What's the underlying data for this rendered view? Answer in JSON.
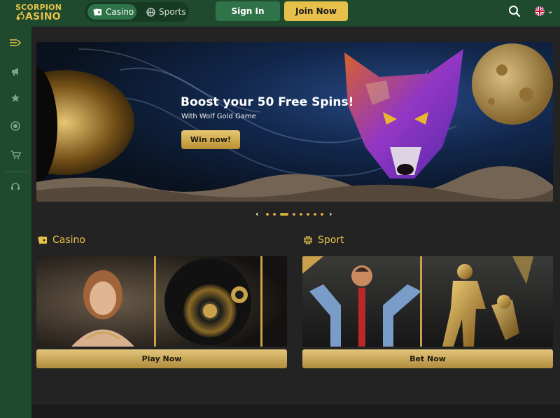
{
  "brand": {
    "line1": "SCORPION",
    "line2": "ASINO"
  },
  "header": {
    "tabs": [
      {
        "label": "Casino",
        "icon": "cards-icon",
        "active": true
      },
      {
        "label": "Sports",
        "icon": "basketball-icon",
        "active": false
      }
    ],
    "signin_label": "Sign In",
    "join_label": "Join Now",
    "search_icon": "search-icon",
    "language_icon": "uk-flag-icon"
  },
  "sidebar": {
    "items": [
      {
        "icon": "collapse-menu-icon"
      },
      {
        "icon": "megaphone-icon"
      },
      {
        "icon": "star-icon"
      },
      {
        "icon": "poker-chip-icon"
      },
      {
        "icon": "cart-icon"
      },
      {
        "icon": "headset-icon"
      }
    ]
  },
  "banner": {
    "title": "Boost your 50 Free Spins!",
    "subtitle": "With Wolf Gold Game",
    "cta": "Win now!"
  },
  "carousel": {
    "prev": "‹",
    "next": "›",
    "count": 8,
    "active_index": 2
  },
  "sections": {
    "casino": {
      "title": "Casino",
      "cta": "Play Now"
    },
    "sport": {
      "title": "Sport",
      "cta": "Bet Now"
    }
  },
  "colors": {
    "accent": "#e6c24a",
    "green": "#1f4a2e",
    "button_green": "#2f7448",
    "background": "#232323"
  }
}
